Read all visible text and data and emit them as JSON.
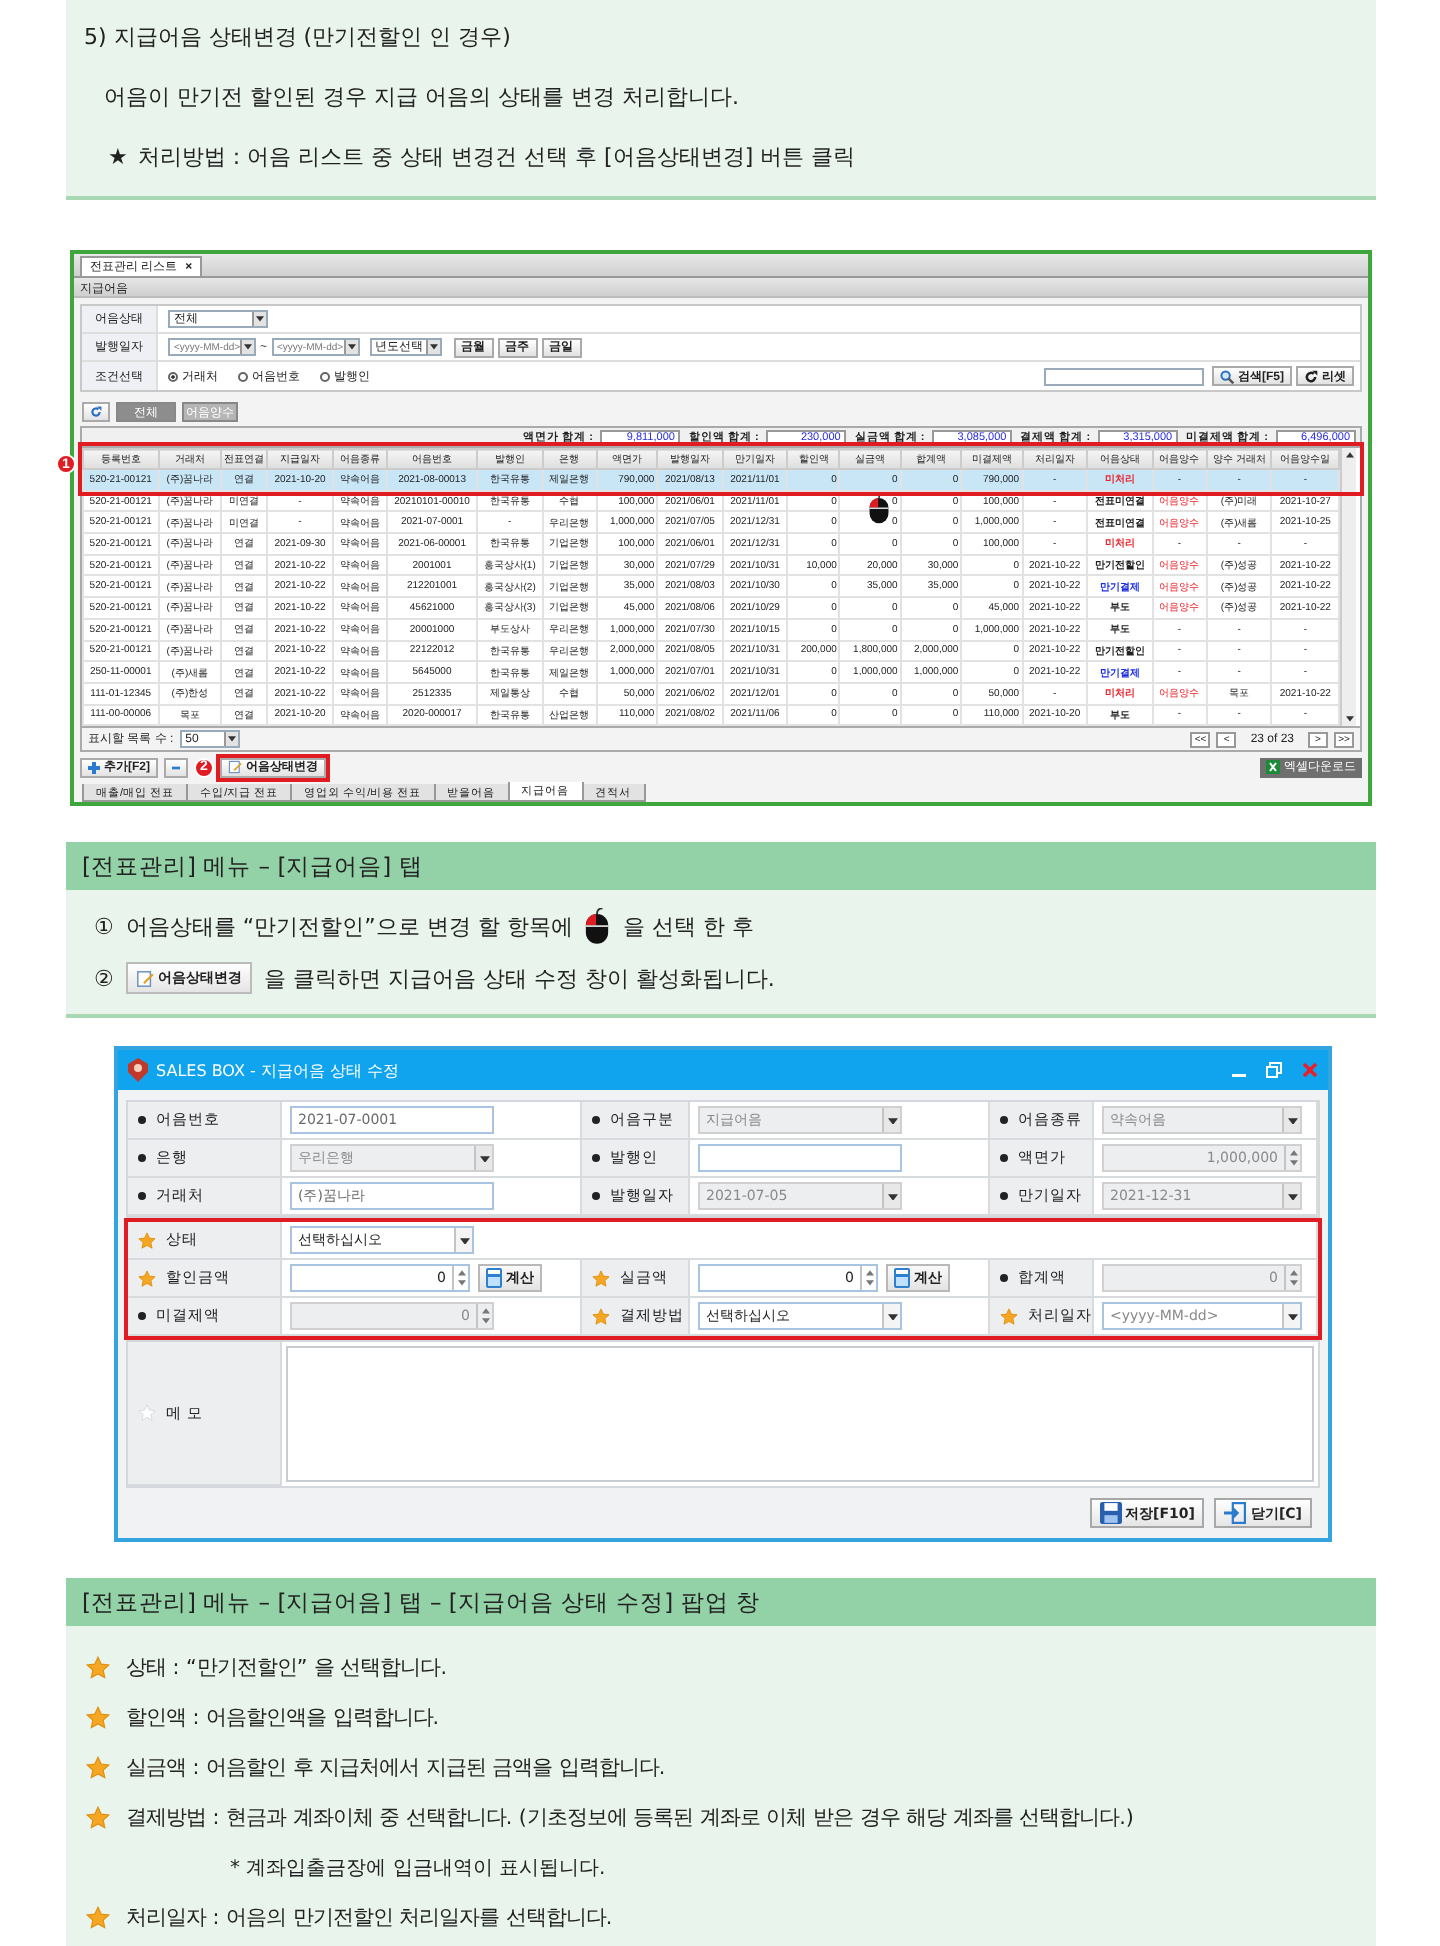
{
  "intro": {
    "title": "5) 지급어음 상태변경 (만기전할인 인 경우)",
    "description": "어음이 만기전 할인된 경우 지급 어음의 상태를 변경 처리합니다.",
    "method_mark": "★",
    "method": "처리방법 : 어음 리스트 중 상태 변경건 선택 후 [어음상태변경] 버튼 클릭"
  },
  "app": {
    "tab": {
      "label": "전표관리 리스트",
      "close": "×"
    },
    "section_title": "지급어음",
    "filters": {
      "status_label": "어음상태",
      "status_value": "전체",
      "date_label": "발행일자",
      "date_from": "<yyyy-MM-dd>",
      "date_sep": "~",
      "date_to": "<yyyy-MM-dd>",
      "year": "년도선택",
      "quick": [
        "금월",
        "금주",
        "금일"
      ],
      "condition_label": "조건선택",
      "options": [
        {
          "label": "거래처",
          "selected": true
        },
        {
          "label": "어음번호",
          "selected": false
        },
        {
          "label": "발행인",
          "selected": false
        }
      ],
      "search_button": "검색[F5]",
      "reset_button": "리셋"
    },
    "view_buttons": [
      {
        "label": "전체",
        "selected": true
      },
      {
        "label": "어음양수",
        "selected": false
      }
    ],
    "totals": [
      {
        "label": "액면가 합계 :",
        "value": "9,811,000"
      },
      {
        "label": "할인액 합계 :",
        "value": "230,000"
      },
      {
        "label": "실금액 합계 :",
        "value": "3,085,000"
      },
      {
        "label": "결제액 합계 :",
        "value": "3,315,000"
      },
      {
        "label": "미결제액 합계 :",
        "value": "6,496,000"
      }
    ],
    "table": {
      "columns": [
        "등록번호",
        "거래처",
        "전표연결",
        "지급일자",
        "어음종류",
        "어음번호",
        "발행인",
        "은행",
        "액면가",
        "발행일자",
        "만기일자",
        "할인액",
        "실금액",
        "합계액",
        "미결제액",
        "처리일자",
        "어음상태",
        "어음양수",
        "양수 거래처",
        "어음양수일"
      ],
      "rows": [
        {
          "selected": true,
          "color": "#e8202a",
          "transferred": false,
          "cells": [
            "520-21-00121",
            "(주)꿈나라",
            "연결",
            "2021-10-20",
            "약속어음",
            "2021-08-00013",
            "한국유통",
            "제일은행",
            "790,000",
            "2021/08/13",
            "2021/11/01",
            "0",
            "0",
            "0",
            "790,000",
            "-",
            "미처리",
            "-",
            "-",
            "-"
          ]
        },
        {
          "selected": false,
          "color": "#222222",
          "transferred": true,
          "cells": [
            "520-21-00121",
            "(주)꿈나라",
            "미연결",
            "-",
            "약속어음",
            "20210101-00010",
            "한국유통",
            "수협",
            "100,000",
            "2021/06/01",
            "2021/11/01",
            "0",
            "0",
            "0",
            "100,000",
            "-",
            "전표미연결",
            "어음양수",
            "(주)미래",
            "2021-10-27"
          ]
        },
        {
          "selected": false,
          "color": "#222222",
          "transferred": true,
          "cells": [
            "520-21-00121",
            "(주)꿈나라",
            "미연결",
            "-",
            "약속어음",
            "2021-07-0001",
            "-",
            "우리은행",
            "1,000,000",
            "2021/07/05",
            "2021/12/31",
            "0",
            "0",
            "0",
            "1,000,000",
            "-",
            "전표미연결",
            "어음양수",
            "(주)새롬",
            "2021-10-25"
          ]
        },
        {
          "selected": false,
          "color": "#e8202a",
          "transferred": false,
          "cells": [
            "520-21-00121",
            "(주)꿈나라",
            "연결",
            "2021-09-30",
            "약속어음",
            "2021-06-00001",
            "한국유통",
            "기업은행",
            "100,000",
            "2021/06/01",
            "2021/12/31",
            "0",
            "0",
            "0",
            "100,000",
            "-",
            "미처리",
            "-",
            "-",
            "-"
          ]
        },
        {
          "selected": false,
          "color": "#222222",
          "transferred": true,
          "cells": [
            "520-21-00121",
            "(주)꿈나라",
            "연결",
            "2021-10-22",
            "약속어음",
            "2001001",
            "흥국상사(1)",
            "기업은행",
            "30,000",
            "2021/07/29",
            "2021/10/31",
            "10,000",
            "20,000",
            "30,000",
            "0",
            "2021-10-22",
            "만기전할인",
            "어음양수",
            "(주)성공",
            "2021-10-22"
          ]
        },
        {
          "selected": false,
          "color": "#1a2ee0",
          "transferred": true,
          "cells": [
            "520-21-00121",
            "(주)꿈나라",
            "연결",
            "2021-10-22",
            "약속어음",
            "212201001",
            "흥국상사(2)",
            "기업은행",
            "35,000",
            "2021/08/03",
            "2021/10/30",
            "0",
            "35,000",
            "35,000",
            "0",
            "2021-10-22",
            "만기결제",
            "어음양수",
            "(주)성공",
            "2021-10-22"
          ]
        },
        {
          "selected": false,
          "color": "#222222",
          "transferred": true,
          "cells": [
            "520-21-00121",
            "(주)꿈나라",
            "연결",
            "2021-10-22",
            "약속어음",
            "45621000",
            "흥국상사(3)",
            "기업은행",
            "45,000",
            "2021/08/06",
            "2021/10/29",
            "0",
            "0",
            "0",
            "45,000",
            "2021-10-22",
            "부도",
            "어음양수",
            "(주)성공",
            "2021-10-22"
          ]
        },
        {
          "selected": false,
          "color": "#222222",
          "transferred": false,
          "cells": [
            "520-21-00121",
            "(주)꿈나라",
            "연결",
            "2021-10-22",
            "약속어음",
            "20001000",
            "부도상사",
            "우리은행",
            "1,000,000",
            "2021/07/30",
            "2021/10/15",
            "0",
            "0",
            "0",
            "1,000,000",
            "2021-10-22",
            "부도",
            "-",
            "-",
            "-"
          ]
        },
        {
          "selected": false,
          "color": "#222222",
          "transferred": false,
          "cells": [
            "520-21-00121",
            "(주)꿈나라",
            "연결",
            "2021-10-22",
            "약속어음",
            "22122012",
            "한국유통",
            "우리은행",
            "2,000,000",
            "2021/08/05",
            "2021/10/31",
            "200,000",
            "1,800,000",
            "2,000,000",
            "0",
            "2021-10-22",
            "만기전할인",
            "-",
            "-",
            "-"
          ]
        },
        {
          "selected": false,
          "color": "#1a2ee0",
          "transferred": false,
          "cells": [
            "250-11-00001",
            "(주)새롬",
            "연결",
            "2021-10-22",
            "약속어음",
            "5645000",
            "한국유통",
            "제일은행",
            "1,000,000",
            "2021/07/01",
            "2021/10/31",
            "0",
            "1,000,000",
            "1,000,000",
            "0",
            "2021-10-22",
            "만기결제",
            "-",
            "-",
            "-"
          ]
        },
        {
          "selected": false,
          "color": "#e8202a",
          "transferred": true,
          "cells": [
            "111-01-12345",
            "(주)한성",
            "연결",
            "2021-10-22",
            "약속어음",
            "2512335",
            "제일통상",
            "수협",
            "50,000",
            "2021/06/02",
            "2021/12/01",
            "0",
            "0",
            "0",
            "50,000",
            "-",
            "미처리",
            "어음양수",
            "목포",
            "2021-10-22"
          ]
        },
        {
          "selected": false,
          "color": "#222222",
          "transferred": false,
          "cells": [
            "111-00-00006",
            "목포",
            "연결",
            "2021-10-20",
            "약속어음",
            "2020-000017",
            "한국유통",
            "산업은행",
            "110,000",
            "2021/08/02",
            "2021/11/06",
            "0",
            "0",
            "0",
            "110,000",
            "2021-10-20",
            "부도",
            "-",
            "-",
            "-"
          ]
        }
      ]
    },
    "page_size_label": "표시할 목록 수 :",
    "page_size": "50",
    "pager": {
      "first": "<<",
      "prev": "<",
      "info": "23 of 23",
      "next": ">",
      "last": ">>"
    },
    "toolbar": {
      "add": "추가[F2]",
      "change": "어음상태변경",
      "excel": "엑셀다운로드"
    },
    "bottom_tabs": [
      {
        "label": "매출/매입 전표",
        "selected": false
      },
      {
        "label": "수입/지급 전표",
        "selected": false
      },
      {
        "label": "영업외 수익/비용 전표",
        "selected": false
      },
      {
        "label": "받을어음",
        "selected": false
      },
      {
        "label": "지급어음",
        "selected": true
      },
      {
        "label": "견적서",
        "selected": false
      }
    ],
    "callouts": [
      "1",
      "2"
    ]
  },
  "tab_note": {
    "heading": "[전표관리] 메뉴 – [지급어음] 탭",
    "steps": [
      {
        "number": "①",
        "kind": "mouse",
        "before": "어음상태를 “만기전할인”으로 변경 할 항목에",
        "after": "을  선택 한 후"
      },
      {
        "number": "②",
        "kind": "button",
        "button": "어음상태변경",
        "after": "을 클릭하면 지급어음 상태 수정 창이 활성화됩니다."
      }
    ]
  },
  "dialog": {
    "title": "SALES BOX - 지급어음 상태 수정",
    "rows": [
      [
        {
          "label": "어음번호",
          "required": false,
          "kind": "text",
          "value": "2021-07-0001",
          "disabled": false,
          "readonly": true
        },
        {
          "label": "어음구분",
          "required": false,
          "kind": "select",
          "value": "지급어음",
          "disabled": true
        },
        {
          "label": "어음종류",
          "required": false,
          "kind": "select",
          "value": "약속어음",
          "disabled": true
        }
      ],
      [
        {
          "label": "은행",
          "required": false,
          "kind": "select",
          "value": "우리은행",
          "disabled": true
        },
        {
          "label": "발행인",
          "required": false,
          "kind": "text",
          "disabled": false
        },
        {
          "label": "액면가",
          "required": false,
          "kind": "number",
          "value": "1,000,000",
          "disabled": true
        }
      ],
      [
        {
          "label": "거래처",
          "required": false,
          "kind": "text",
          "value": "(주)꿈나라",
          "disabled": false,
          "readonly": true
        },
        {
          "label": "발행일자",
          "required": false,
          "kind": "select",
          "value": "2021-07-05",
          "disabled": true
        },
        {
          "label": "만기일자",
          "required": false,
          "kind": "select",
          "value": "2021-12-31",
          "disabled": true
        }
      ]
    ],
    "highlighted_rows": [
      [
        {
          "label": "상태",
          "required": true,
          "kind": "select",
          "value": "선택하십시오",
          "disabled": false
        }
      ],
      [
        {
          "label": "할인금액",
          "required": true,
          "kind": "number",
          "value": "0",
          "calc_button": "계산",
          "disabled": false
        },
        {
          "label": "실금액",
          "required": true,
          "kind": "number",
          "value": "0",
          "calc_button": "계산",
          "disabled": false
        },
        {
          "label": "합계액",
          "required": false,
          "kind": "number",
          "value": "0",
          "disabled": true
        }
      ],
      [
        {
          "label": "미결제액",
          "required": false,
          "kind": "number",
          "value": "0",
          "disabled": true
        },
        {
          "label": "결제방법",
          "required": true,
          "kind": "select",
          "value": "선택하십시오",
          "disabled": false
        },
        {
          "label": "처리일자",
          "required": true,
          "kind": "select",
          "placeholder": "<yyyy-MM-dd>",
          "disabled": false
        }
      ]
    ],
    "memo": {
      "label": "메 모"
    },
    "buttons": [
      {
        "label": "저장[F10]",
        "kind": "save"
      },
      {
        "label": "닫기[C]",
        "kind": "close"
      }
    ]
  },
  "popup_note": {
    "heading": "[전표관리] 메뉴 – [지급어음] 탭 – [지급어음 상태 수정] 팝업 창",
    "items": [
      {
        "kind": "item",
        "text": "상태 :  “만기전할인” 을 선택합니다."
      },
      {
        "kind": "item",
        "text": "할인액 : 어음할인액을 입력합니다."
      },
      {
        "kind": "item",
        "text": "실금액 : 어음할인 후 지급처에서 지급된 금액을 입력합니다."
      },
      {
        "kind": "item",
        "text": "결제방법 : 현금과 계좌이체 중 선택합니다. (기초정보에 등록된 계좌로 이체 받은 경우 해당 계좌를 선택합니다.)"
      },
      {
        "kind": "note",
        "text": "* 계좌입출금장에 입금내역이 표시됩니다."
      },
      {
        "kind": "item",
        "text": "처리일자 : 어음의 만기전할인 처리일자를 선택합니다."
      }
    ]
  }
}
